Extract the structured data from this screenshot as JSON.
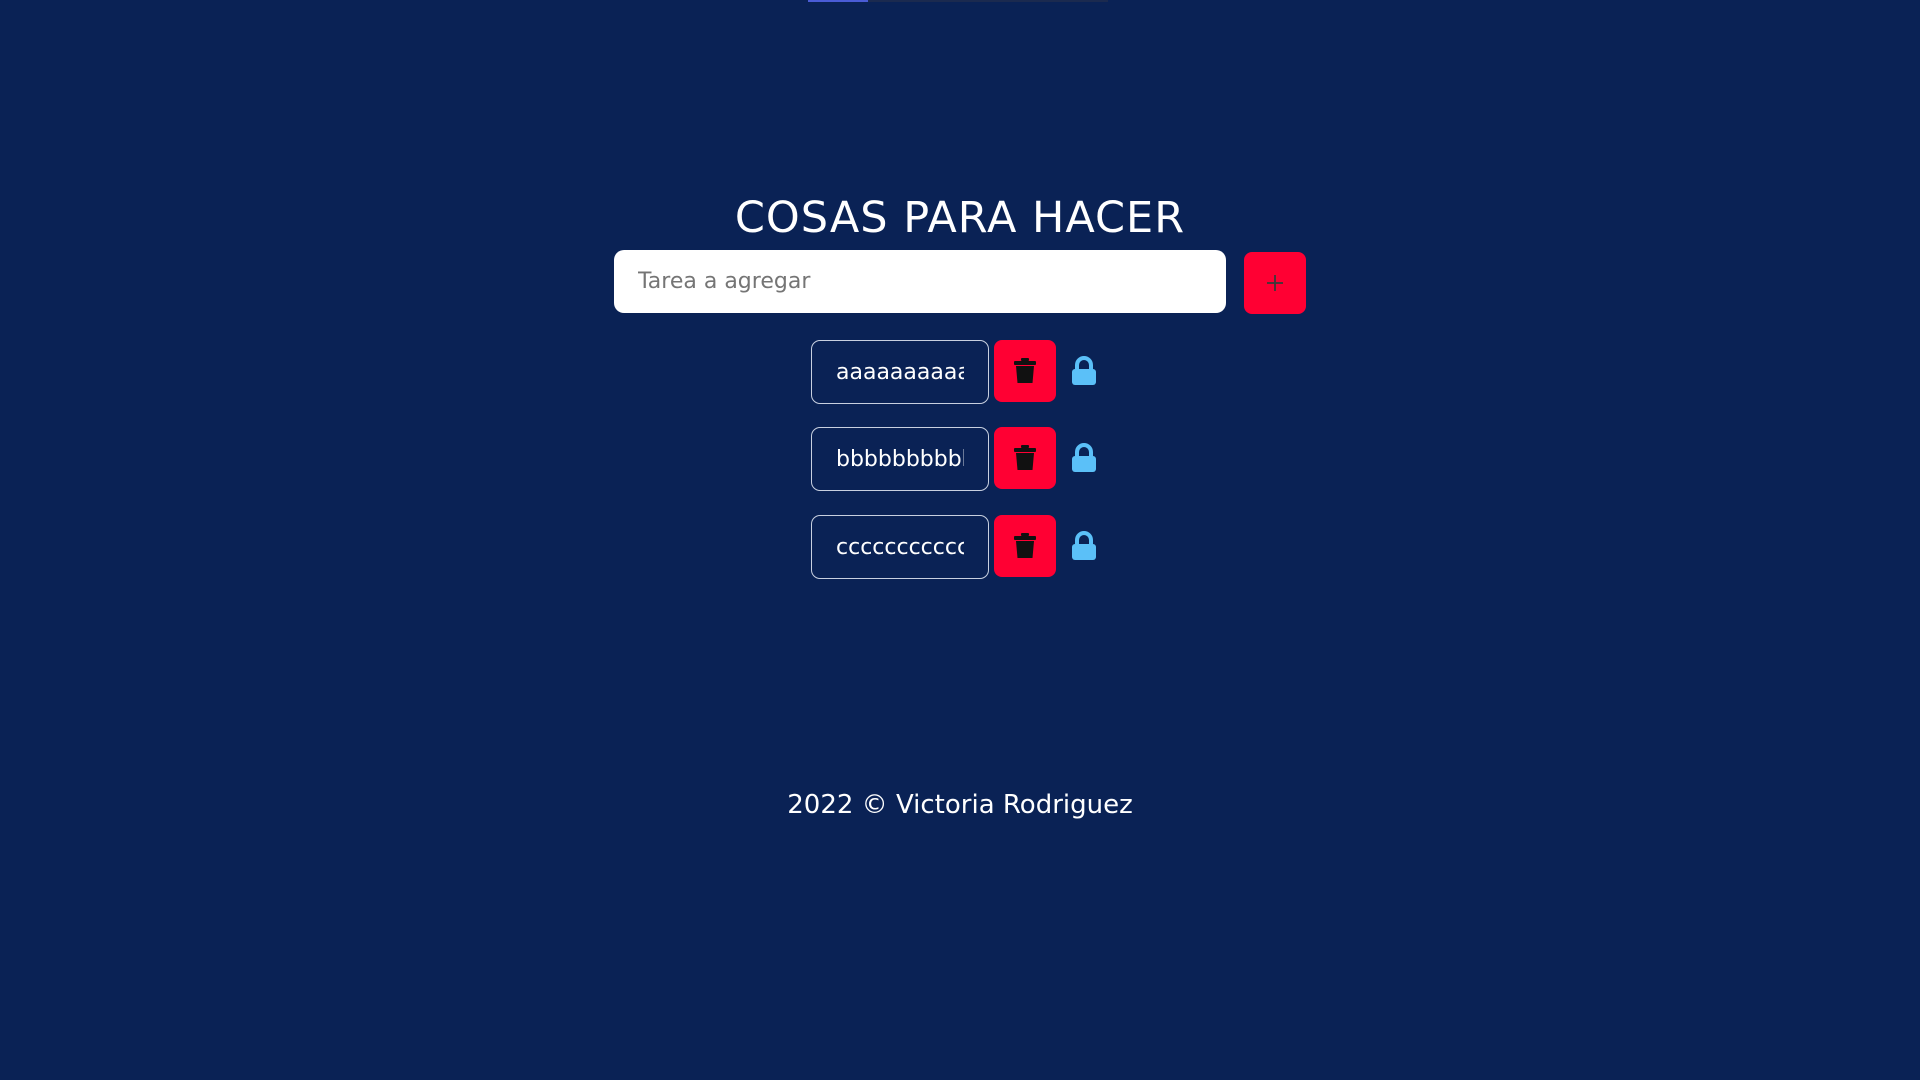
{
  "page": {
    "title": "COSAS PARA HACER",
    "footer": "2022 © Victoria Rodriguez"
  },
  "add_form": {
    "placeholder": "Tarea a agregar",
    "value": "",
    "button_icon": "plus-icon"
  },
  "top_progress": {
    "fraction": 0.2
  },
  "tasks": [
    {
      "text": "aaaaaaaaaaaaaaa",
      "delete_icon": "trash-icon",
      "lock_icon": "lock-icon"
    },
    {
      "text": "bbbbbbbbbbb",
      "delete_icon": "trash-icon",
      "lock_icon": "lock-icon"
    },
    {
      "text": "ccccccccccccc",
      "delete_icon": "trash-icon",
      "lock_icon": "lock-icon"
    }
  ],
  "colors": {
    "background": "#0a2255",
    "accent": "#ff0033",
    "lock": "#5bc0f8",
    "text": "#ffffff"
  }
}
